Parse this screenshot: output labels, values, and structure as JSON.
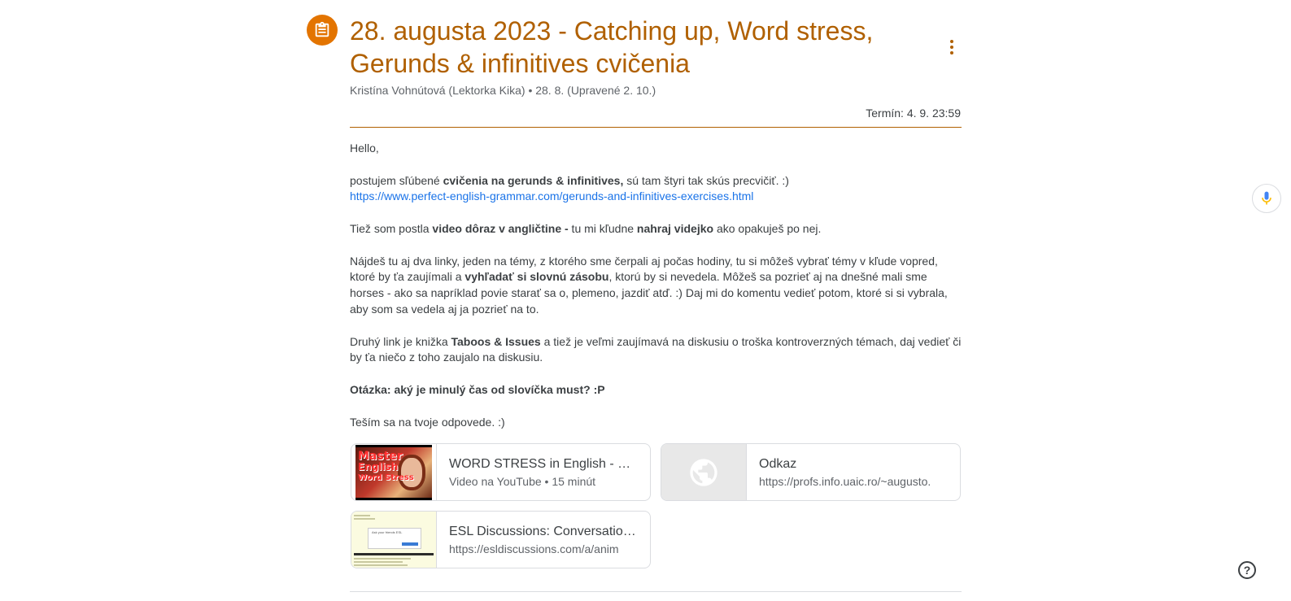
{
  "assignment": {
    "title": "28. augusta 2023 - Catching up, Word stress, Gerunds & infinitives cvičenia",
    "meta": "Kristína Vohnútová (Lektorka Kika) • 28. 8. (Upravené 2. 10.)",
    "due": "Termín: 4. 9. 23:59"
  },
  "body": {
    "greeting": "Hello,",
    "p1_pre": "postujem sľúbené ",
    "p1_bold": "cvičenia na gerunds & infinitives,",
    "p1_post": " sú tam štyri tak skús precvičiť. :)",
    "p1_link": "https://www.perfect-english-grammar.com/gerunds-and-infinitives-exercises.html",
    "p2_pre": "Tiež som postla ",
    "p2_bold1": "video dôraz v angličtine -",
    "p2_mid": " tu mi kľudne ",
    "p2_bold2": "nahraj videjko",
    "p2_post": " ako opakuješ po nej.",
    "p3_pre": "Nájdeš tu aj dva linky, jeden na témy, z ktorého sme čerpali aj počas hodiny, tu si môžeš vybrať témy v kľude vopred, ktoré by ťa zaujímali a ",
    "p3_bold": "vyhľadať si slovnú zásobu",
    "p3_post": ", ktorú by si nevedela. Môžeš sa pozrieť aj na dnešné mali sme horses - ako sa napríklad povie starať sa o, plemeno, jazdiť atď. :) Daj mi do komentu vedieť potom, ktoré si si vybrala, aby som sa vedela aj ja pozrieť na to.",
    "p4_pre": "Druhý link je knižka ",
    "p4_bold": "Taboos & Issues",
    "p4_post": " a tiež je veľmi zaujímavá na diskusiu o troška kontroverzných témach, daj vedieť či by ťa niečo z toho zaujalo na diskusiu.",
    "question": "Otázka: aký je minulý čas od slovíčka must? :P",
    "closing": "Teším sa na tvoje odpovede. :)"
  },
  "attachments": [
    {
      "title": "WORD STRESS in English - Word Stress",
      "subtitle": "Video na YouTube • 15 minút",
      "thumb_text": [
        "8 Simple Rules",
        "Master",
        "English",
        "Word Stress"
      ]
    },
    {
      "title": "Odkaz",
      "subtitle": "https://profs.info.uaic.ro/~augusto.",
      "thumb_icon": "globe-icon"
    },
    {
      "title": "ESL Discussions: Conversation Questions",
      "subtitle": "https://esldiscussions.com/a/anim",
      "thumb_text": "Ask your friends ESL"
    }
  ],
  "colors": {
    "accent": "#b06000",
    "icon_bg": "#e37400",
    "link": "#1a73e8"
  }
}
